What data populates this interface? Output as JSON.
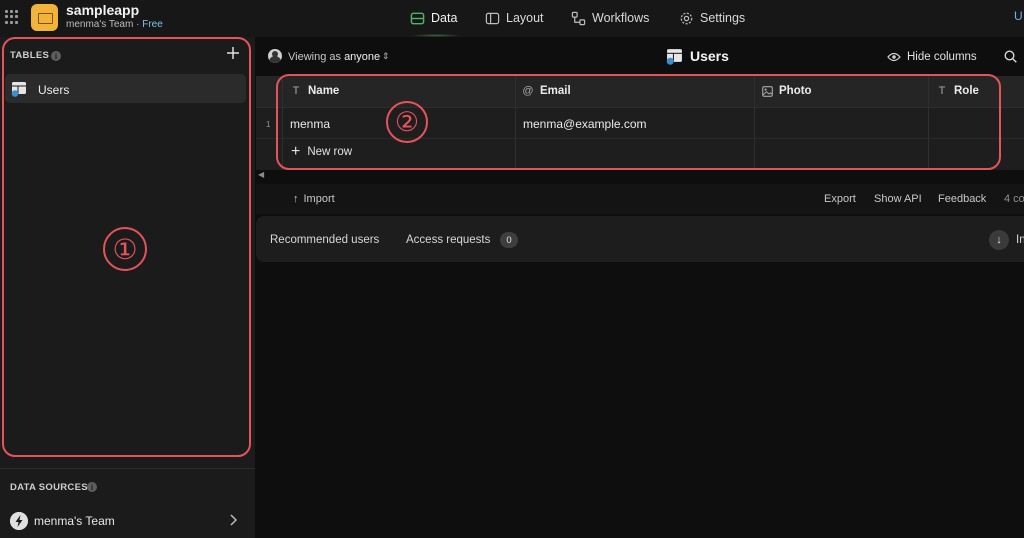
{
  "app": {
    "name": "sampleapp",
    "team": "menma's Team",
    "separator": "·",
    "plan": "Free"
  },
  "nav": [
    {
      "label": "Data",
      "icon": "database-icon",
      "active": true
    },
    {
      "label": "Layout",
      "icon": "layout-icon",
      "active": false
    },
    {
      "label": "Workflows",
      "icon": "workflows-icon",
      "active": false
    },
    {
      "label": "Settings",
      "icon": "gear-icon",
      "active": false
    }
  ],
  "topbar": {
    "cut_text": "U"
  },
  "sidebar": {
    "tables_heading": "TABLES",
    "tables": [
      {
        "label": "Users",
        "active": true
      }
    ],
    "data_sources_heading": "DATA SOURCES",
    "data_sources": [
      {
        "label": "menma's Team"
      }
    ]
  },
  "toolbar": {
    "viewing_prefix": "Viewing as",
    "viewing_value": "anyone",
    "title": "Users",
    "hide_columns": "Hide columns"
  },
  "table": {
    "columns": [
      {
        "label": "Name",
        "type_icon": "T"
      },
      {
        "label": "Email",
        "type_icon": "@"
      },
      {
        "label": "Photo",
        "type_icon": "image-icon"
      },
      {
        "label": "Role",
        "type_icon": "T"
      }
    ],
    "rows": [
      {
        "num": "1",
        "name": "menma",
        "email": "menma@example.com",
        "photo": "",
        "role": ""
      }
    ],
    "new_row": "New row"
  },
  "footer": {
    "import": "Import",
    "export": "Export",
    "show_api": "Show API",
    "feedback": "Feedback",
    "count": "4 co"
  },
  "users_panel": {
    "tabs": [
      {
        "label": "Recommended users"
      },
      {
        "label": "Access requests",
        "badge": "0"
      }
    ],
    "cut_text": "In"
  },
  "annotations": [
    {
      "label": "①"
    },
    {
      "label": "②"
    }
  ],
  "colors": {
    "annotation": "#e5535b",
    "app_logo": "#f2b33a",
    "plan": "#7fc2e8"
  }
}
